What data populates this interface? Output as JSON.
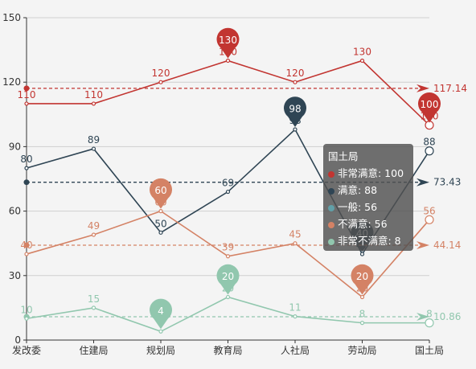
{
  "chart_data": {
    "type": "line",
    "categories": [
      "发改委",
      "住建局",
      "规划局",
      "教育局",
      "人社局",
      "劳动局",
      "国土局"
    ],
    "ylim": [
      0,
      150
    ],
    "yticks": [
      0,
      30,
      60,
      90,
      120,
      150
    ],
    "grid": true,
    "series": [
      {
        "name": "非常满意",
        "color": "#c23531",
        "values": [
          110,
          110,
          120,
          130,
          120,
          130,
          100
        ],
        "max": 130,
        "min": 100,
        "average": 117.14
      },
      {
        "name": "满意",
        "color": "#2f4554",
        "values": [
          80,
          89,
          50,
          69,
          98,
          40,
          88
        ],
        "max": 98,
        "min": 40,
        "average": 73.43
      },
      {
        "name": "一般",
        "color": "#61a0a8",
        "values": [],
        "max": null,
        "min": null,
        "average": null
      },
      {
        "name": "不满意",
        "color": "#d48265",
        "values": [
          40,
          49,
          60,
          39,
          45,
          20,
          56
        ],
        "max": 60,
        "min": 20,
        "average": 44.14
      },
      {
        "name": "非常不满意",
        "color": "#91c7ae",
        "values": [
          10,
          15,
          4,
          20,
          11,
          8,
          8
        ],
        "max": 20,
        "min": 4,
        "average": 10.86
      }
    ]
  },
  "tooltip": {
    "title": "国土局",
    "rows": [
      "非常满意: 100",
      "满意: 88",
      "一般: 56",
      "不满意: 56",
      "非常不满意: 8"
    ],
    "colors": [
      "#c23531",
      "#2f4554",
      "#61a0a8",
      "#d48265",
      "#91c7ae"
    ]
  }
}
